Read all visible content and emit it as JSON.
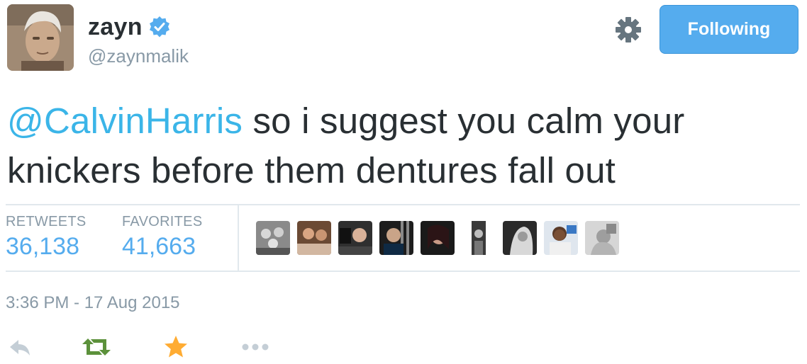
{
  "user": {
    "display_name": "zayn",
    "handle": "@zaynmalik",
    "verified": true
  },
  "follow_button": {
    "label": "Following"
  },
  "tweet": {
    "mention": "@CalvinHarris",
    "text_line1": " so i suggest you calm your",
    "text_line2": "knickers before them dentures fall out"
  },
  "stats": {
    "retweets_label": "RETWEETS",
    "retweets_value": "36,138",
    "favorites_label": "FAVORITES",
    "favorites_value": "41,663"
  },
  "favoriter_avatars": [
    "avatar-1",
    "avatar-2",
    "avatar-3",
    "avatar-4",
    "avatar-5",
    "avatar-6",
    "avatar-7",
    "avatar-8",
    "avatar-9"
  ],
  "timestamp": "3:36 PM - 17 Aug 2015",
  "actions": [
    "reply-icon",
    "retweet-icon",
    "favorite-icon",
    "more-icon"
  ],
  "colors": {
    "accent": "#55acee",
    "mention": "#3bb5e8",
    "retweet": "#5c913b",
    "favorite": "#ffac33",
    "muted": "#8899a6"
  }
}
